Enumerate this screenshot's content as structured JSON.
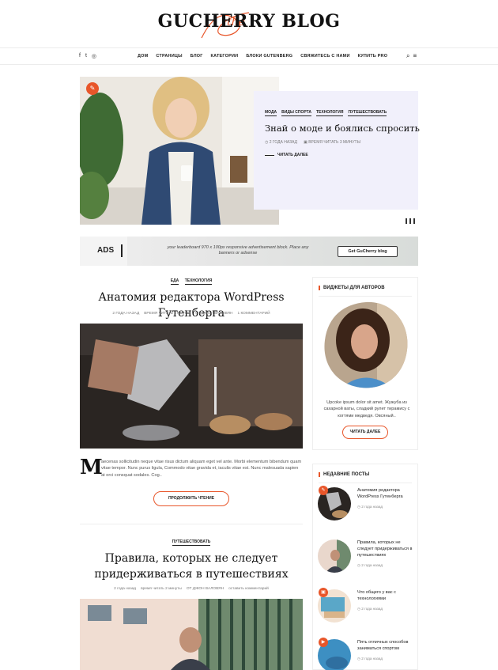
{
  "header": {
    "logo_script": "the",
    "logo_text": "GUCHERRY BLOG",
    "social_icons": [
      "facebook-icon",
      "twitter-icon",
      "instagram-icon"
    ],
    "menu": [
      "ДОМ",
      "СТРАНИЦЫ",
      "БЛОГ",
      "КАТЕГОРИИ",
      "БЛОКИ GUTENBERG",
      "СВЯЖИТЕСЬ С НАМИ",
      "КУПИТЬ PRO"
    ],
    "tools": [
      "search-icon",
      "menu-icon"
    ]
  },
  "hero": {
    "badge_icon": "edit-icon",
    "categories": [
      "МОДА",
      "ВИДЫ СПОРТА",
      "ТЕХНОЛОГИЯ",
      "ПУТЕШЕСТВОВАТЬ"
    ],
    "title": "Знай о моде и боялись спросить",
    "meta_date": "2 ГОДА НАЗАД",
    "meta_read": "ВРЕМЯ ЧИТАТЬ 3 МИНУТЫ",
    "read_more": "ЧИТАТЬ ДАЛЕЕ",
    "accent_color": "#e8562a",
    "card_color": "#f1f0fb"
  },
  "ads": {
    "label": "ADS",
    "text": "your leaderboard 970 x 100px responsive advertisement block. Place any banners or adsense",
    "button": "Get GuCherry blog"
  },
  "post1": {
    "categories": [
      "ЕДА",
      "ТЕХНОЛОГИЯ"
    ],
    "title": "Анатомия редактора WordPress Гутенберга",
    "meta": [
      "2 ГОДА НАЗАД",
      "ВРЕМЯ ЧИТАТЬ 4 МИНУТ",
      "ОТ ДЖОН ВАЛОВЯН",
      "1 КОММЕНТАРИЙ"
    ],
    "dropcap": "M",
    "excerpt": "aecenas sollicitudin neque vitae risus dictum aliquam eget vel ante. Morbi elementum bibendum quam vitae tempor. Nunc purus ligula, Commodo vitae gravida et, iaculis vitae est. Nunc malesuada sapien at orci consquat sodales. Cog..",
    "continue": "ПРОДОЛЖИТЬ ЧТЕНИЕ"
  },
  "post2": {
    "categories": [
      "ПУТЕШЕСТВОВАТЬ"
    ],
    "title_line1": "Правила, которых не следует",
    "title_line2": "придерживаться в путешествиях",
    "meta": [
      "2 года назад",
      "время читать 2 минуты",
      "ОТ ДЖОН ВАЛОВЯН",
      "оставить комментарий"
    ]
  },
  "sidebar": {
    "author_widget": {
      "title": "ВИДЖЕТЫ ДЛЯ АВТОРОВ",
      "text": "Upcoke ipsum dolor sit amet. Жужуба из сахарной ваты, сладкий рулет тирамису с когтями медведя. Овсяный..",
      "button": "ЧИТАТЬ ДАЛЕЕ"
    },
    "recent_widget": {
      "title": "НЕДАВНИЕ ПОСТЫ",
      "posts": [
        {
          "title": "Анатомия редактора WordPress Гутенберга",
          "date": "2 года назад",
          "badge": "edit-icon"
        },
        {
          "title": "Правила, которых не следует придерживаться в путешествиях",
          "date": "2 года назад",
          "badge": ""
        },
        {
          "title": "Что общего у вас с технологиями",
          "date": "2 года назад",
          "badge": "image-icon"
        },
        {
          "title": "Пять отличных способов заниматься спортом",
          "date": "2 года назад",
          "badge": "video-icon"
        }
      ]
    }
  }
}
